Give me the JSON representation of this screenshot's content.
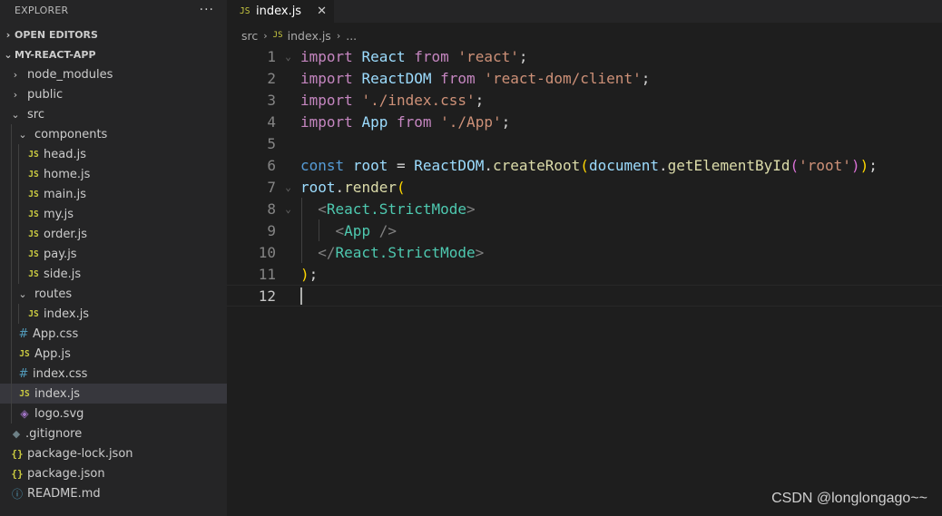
{
  "explorer": {
    "title": "EXPLORER",
    "more_label": "···",
    "open_editors": "OPEN EDITORS",
    "project": "MY-REACT-APP",
    "items": [
      {
        "label": "node_modules",
        "type": "folder"
      },
      {
        "label": "public",
        "type": "folder"
      },
      {
        "label": "src",
        "type": "folder"
      },
      {
        "label": "components",
        "type": "folder"
      },
      {
        "label": "head.js",
        "type": "js"
      },
      {
        "label": "home.js",
        "type": "js"
      },
      {
        "label": "main.js",
        "type": "js"
      },
      {
        "label": "my.js",
        "type": "js"
      },
      {
        "label": "order.js",
        "type": "js"
      },
      {
        "label": "pay.js",
        "type": "js"
      },
      {
        "label": "side.js",
        "type": "js"
      },
      {
        "label": "routes",
        "type": "folder"
      },
      {
        "label": "index.js",
        "type": "js"
      },
      {
        "label": "App.css",
        "type": "css"
      },
      {
        "label": "App.js",
        "type": "js"
      },
      {
        "label": "index.css",
        "type": "css"
      },
      {
        "label": "index.js",
        "type": "js",
        "selected": true
      },
      {
        "label": "logo.svg",
        "type": "svg"
      },
      {
        "label": ".gitignore",
        "type": "git"
      },
      {
        "label": "package-lock.json",
        "type": "json"
      },
      {
        "label": "package.json",
        "type": "json"
      },
      {
        "label": "README.md",
        "type": "info"
      }
    ]
  },
  "icons": {
    "js": "JS",
    "css": "#",
    "json": "{}",
    "git": "◆",
    "info": "ⓘ",
    "svg": "◈",
    "chevron_right": "›",
    "chevron_down": "⌄",
    "close": "✕"
  },
  "tab": {
    "label": "index.js"
  },
  "breadcrumbs": {
    "folder": "src",
    "file": "index.js",
    "more": "..."
  },
  "code": {
    "line_numbers": [
      "1",
      "2",
      "3",
      "4",
      "5",
      "6",
      "7",
      "8",
      "9",
      "10",
      "11",
      "12"
    ],
    "l1": {
      "import": "import",
      "name": "React",
      "from": "from",
      "module": "'react'",
      "end": ";"
    },
    "l2": {
      "import": "import",
      "name": "ReactDOM",
      "from": "from",
      "module": "'react-dom/client'",
      "end": ";"
    },
    "l3": {
      "import": "import",
      "module": "'./index.css'",
      "end": ";"
    },
    "l4": {
      "import": "import",
      "name": "App",
      "from": "from",
      "module": "'./App'",
      "end": ";"
    },
    "l6": {
      "const": "const",
      "name": "root",
      "eq": "=",
      "obj": "ReactDOM",
      "dot": ".",
      "method": "createRoot",
      "open": "(",
      "doc": "document",
      "dot2": ".",
      "getter": "getElementById",
      "open2": "(",
      "arg": "'root'",
      "close2": ")",
      "close": ")",
      "end": ";"
    },
    "l7": {
      "obj": "root",
      "dot": ".",
      "method": "render",
      "open": "("
    },
    "l8": {
      "lt": "<",
      "tag": "React.StrictMode",
      "gt": ">"
    },
    "l9": {
      "lt": "<",
      "tag": "App",
      "selfclose": " />"
    },
    "l10": {
      "lt": "</",
      "tag": "React.StrictMode",
      "gt": ">"
    },
    "l11": {
      "close": ")",
      "end": ";"
    }
  },
  "watermark": "CSDN @longlongago~~"
}
